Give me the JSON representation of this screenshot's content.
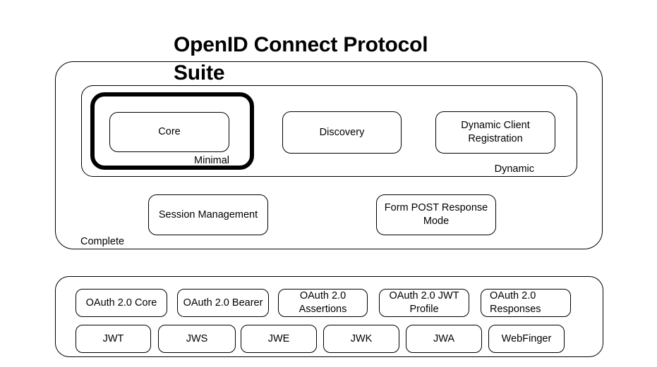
{
  "title": "OpenID Connect Protocol Suite",
  "groups": {
    "complete": {
      "label": "Complete"
    },
    "dynamic": {
      "label": "Dynamic"
    },
    "minimal": {
      "label": "Minimal"
    }
  },
  "upper_tier": {
    "core": "Core",
    "discovery": "Discovery",
    "dynamic_client_registration": "Dynamic Client Registration",
    "session_management": "Session Management",
    "form_post_response_mode": "Form POST Response Mode"
  },
  "foundation": {
    "row1": [
      "OAuth 2.0 Core",
      "OAuth 2.0 Bearer",
      "OAuth 2.0 Assertions",
      "OAuth 2.0 JWT Profile",
      "OAuth 2.0 Responses"
    ],
    "row2": [
      "JWT",
      "JWS",
      "JWE",
      "JWK",
      "JWA",
      "WebFinger"
    ]
  },
  "colors": {
    "background": "#ffffff",
    "stroke": "#000000",
    "text": "#000000",
    "emphasis_stroke": "#000000"
  }
}
